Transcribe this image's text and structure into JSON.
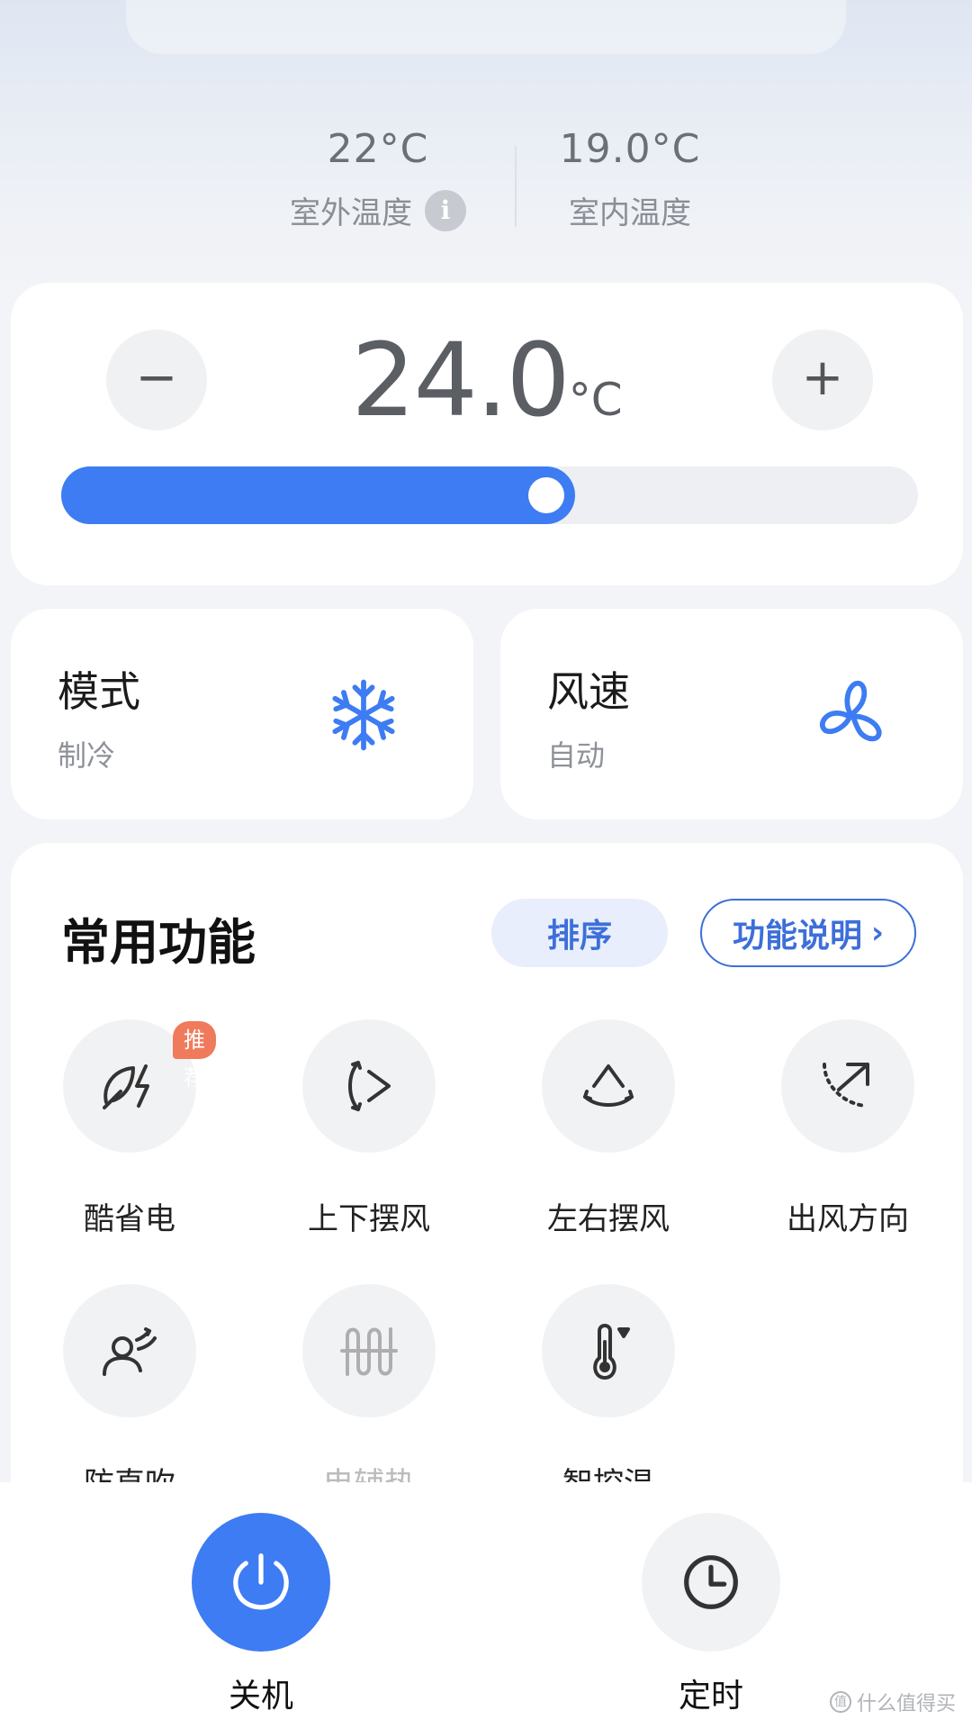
{
  "outdoor": {
    "value": "22°C",
    "label": "室外温度"
  },
  "indoor": {
    "value": "19.0°C",
    "label": "室内温度"
  },
  "setpoint": {
    "value": "24.0",
    "unit": "°C",
    "minus": "−",
    "plus": "+",
    "slider_fraction": 0.6
  },
  "mode_card": {
    "title": "模式",
    "value": "制冷",
    "icon": "snowflake-icon"
  },
  "fan_card": {
    "title": "风速",
    "value": "自动",
    "icon": "fan-icon"
  },
  "functions": {
    "title": "常用功能",
    "sort_label": "排序",
    "explain_label": "功能说明",
    "items": [
      {
        "label": "酷省电",
        "icon": "leaf-bolt-icon",
        "badge": "推荐"
      },
      {
        "label": "上下摆风",
        "icon": "vertical-swing-icon"
      },
      {
        "label": "左右摆风",
        "icon": "horizontal-swing-icon"
      },
      {
        "label": "出风方向",
        "icon": "wind-direction-icon"
      },
      {
        "label": "防直吹",
        "icon": "anti-direct-blow-icon"
      },
      {
        "label": "电辅热",
        "icon": "electric-heat-icon",
        "disabled": true
      },
      {
        "label": "智控温",
        "icon": "thermometer-icon"
      }
    ]
  },
  "bottom": {
    "power_label": "关机",
    "timer_label": "定时"
  },
  "watermark": "什么值得买",
  "colors": {
    "accent": "#3d7cf2",
    "badge": "#f07b5c",
    "link": "#3d6fd9"
  }
}
